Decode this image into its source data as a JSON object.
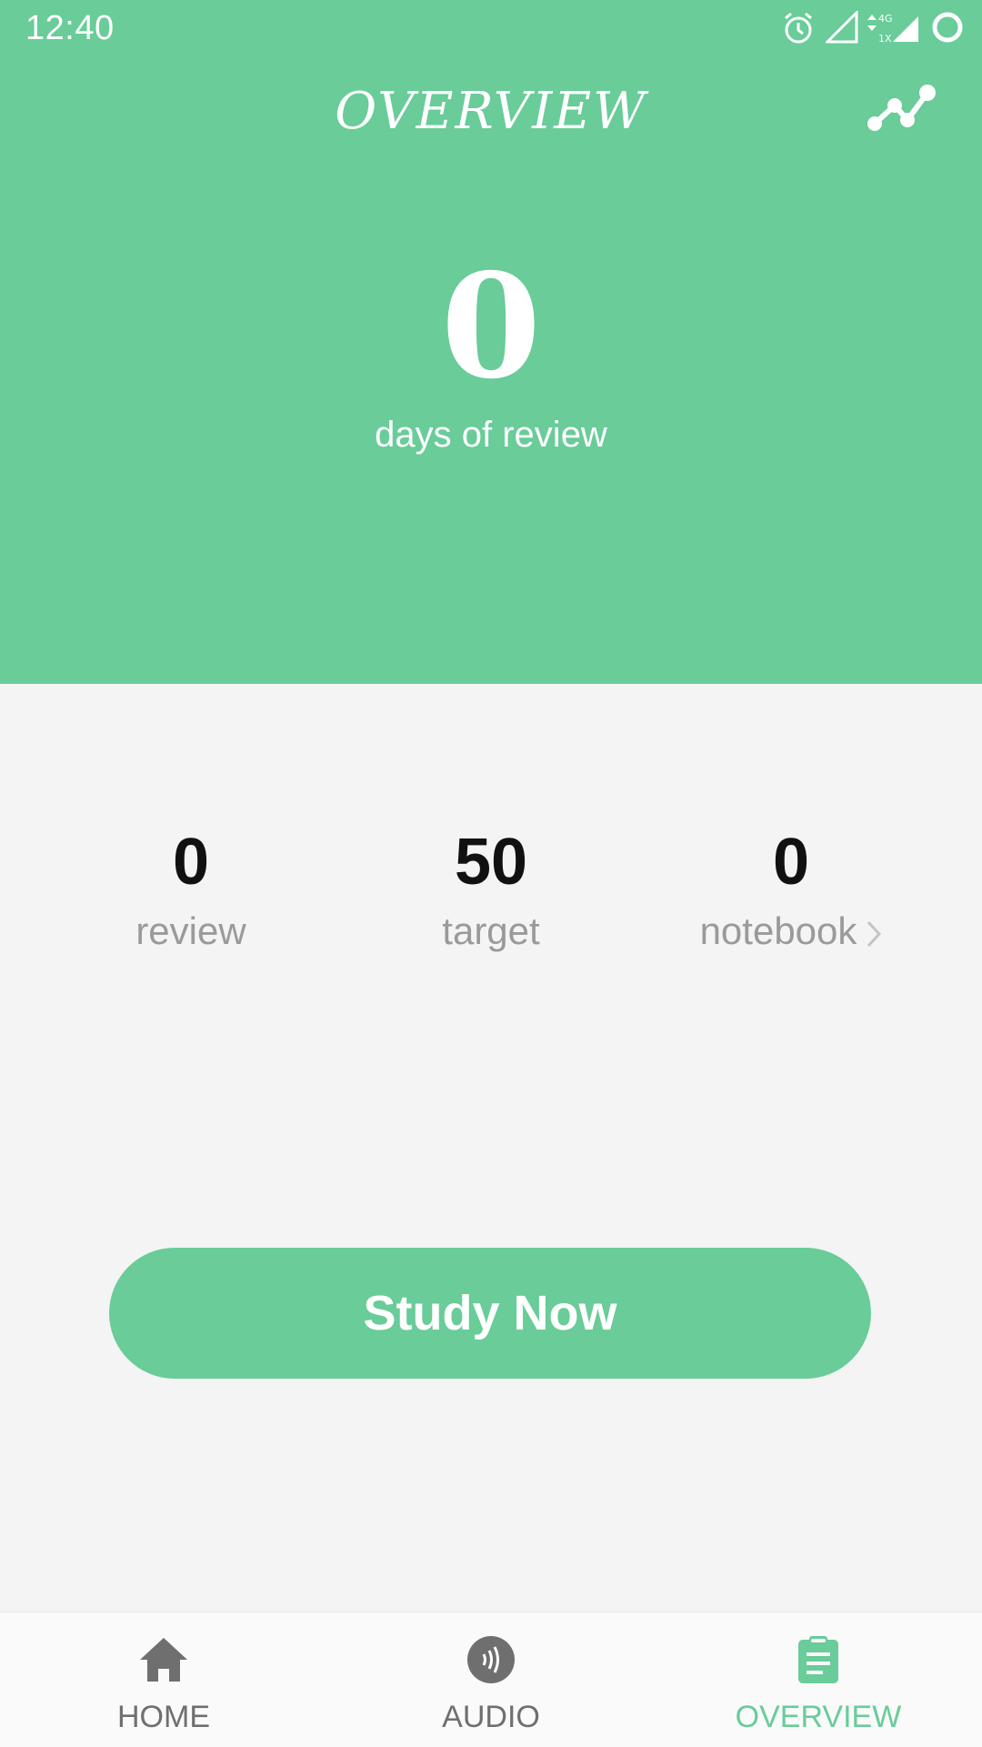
{
  "status_bar": {
    "time": "12:40",
    "icons": [
      "alarm-icon",
      "signal-icon",
      "data-4g-icon",
      "signal-full-icon",
      "battery-ring-icon"
    ],
    "network_label_top": "4G",
    "network_label_bottom": "1X"
  },
  "header": {
    "title": "OVERVIEW",
    "chart_icon": "line-chart-icon"
  },
  "hero": {
    "days_value": "0",
    "days_caption": "days of review"
  },
  "stats": {
    "review": {
      "value": "0",
      "label": "review"
    },
    "target": {
      "value": "50",
      "label": "target"
    },
    "notebook": {
      "value": "0",
      "label": "notebook"
    }
  },
  "actions": {
    "study_label": "Study Now"
  },
  "bottom_nav": {
    "home_label": "HOME",
    "audio_label": "AUDIO",
    "overview_label": "OVERVIEW",
    "active": "OVERVIEW"
  },
  "colors": {
    "accent": "#69cc99",
    "background": "#f4f4f4",
    "nav_inactive": "#6f6f6f"
  }
}
